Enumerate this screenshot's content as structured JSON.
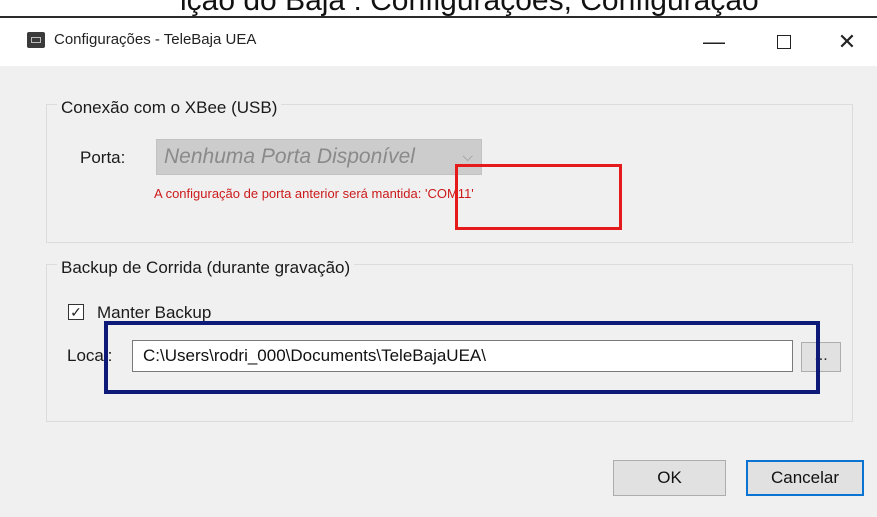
{
  "page_header_fragment": "ição do Baja   :  Configurações, Configuração",
  "window": {
    "title": "Configurações - TeleBaja UEA",
    "minimize_label": "—",
    "close_label": "✕",
    "icon": "app-window-icon"
  },
  "xbee_group": {
    "title": "Conexão com o XBee (USB)",
    "port_label": "Porta:",
    "port_value": "Nenhuma Porta Disponível",
    "port_enabled": false,
    "warning": "A configuração de porta anterior será mantida: 'COM11'",
    "warning_color": "#cc1a1a"
  },
  "backup_group": {
    "title": "Backup de Corrida (durante gravação)",
    "keep_backup_label": "Manter Backup",
    "keep_backup_checked": true,
    "location_label": "Local:",
    "location_value": "C:\\Users\\rodri_000\\Documents\\TeleBajaUEA\\",
    "browse_label": "..."
  },
  "footer": {
    "ok_label": "OK",
    "cancel_label": "Cancelar"
  },
  "annotations": {
    "red_box_color": "#e51b1b",
    "blue_box_color": "#0d1a78"
  },
  "accent_color": "#0a74d4"
}
